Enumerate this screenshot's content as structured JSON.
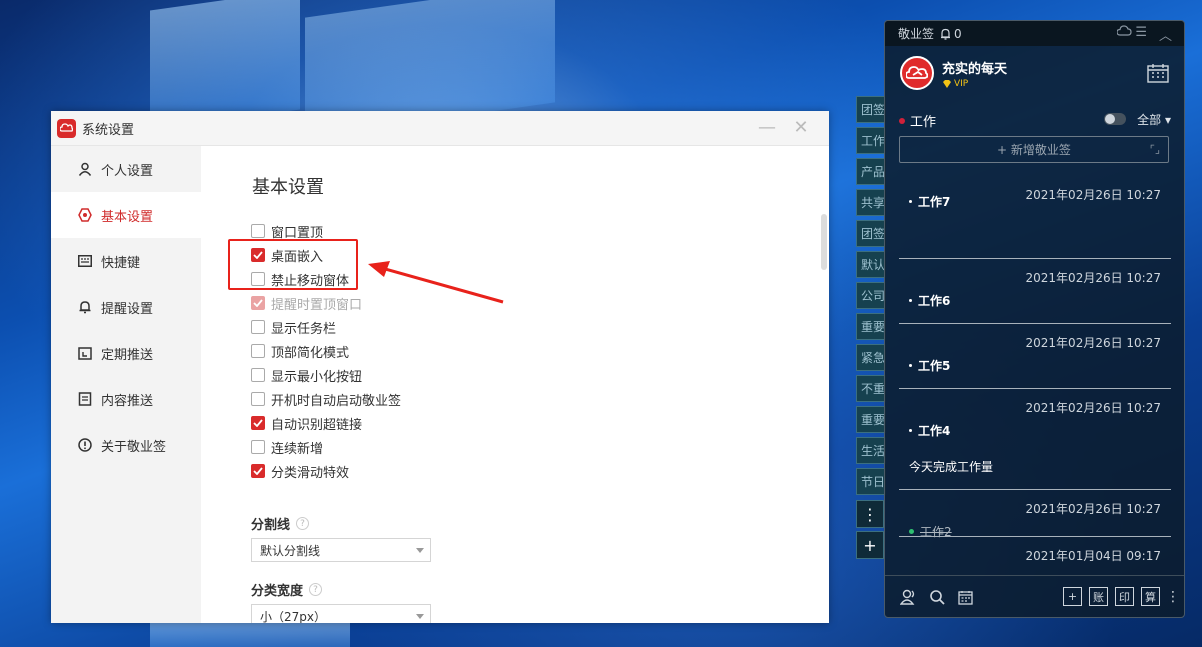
{
  "settings_window": {
    "title": "系统设置",
    "nav": [
      {
        "label": "个人设置",
        "icon": "person-icon",
        "active": false
      },
      {
        "label": "基本设置",
        "icon": "gear-icon",
        "active": true
      },
      {
        "label": "快捷键",
        "icon": "keyboard-icon",
        "active": false
      },
      {
        "label": "提醒设置",
        "icon": "bell-icon",
        "active": false
      },
      {
        "label": "定期推送",
        "icon": "calendar-icon",
        "active": false
      },
      {
        "label": "内容推送",
        "icon": "document-icon",
        "active": false
      },
      {
        "label": "关于敬业签",
        "icon": "info-icon",
        "active": false
      }
    ],
    "section_title": "基本设置",
    "options": [
      {
        "label": "窗口置顶",
        "state": "unchecked"
      },
      {
        "label": "桌面嵌入",
        "state": "checked"
      },
      {
        "label": "禁止移动窗体",
        "state": "unchecked"
      },
      {
        "label": "提醒时置顶窗口",
        "state": "disabled-checked"
      },
      {
        "label": "显示任务栏",
        "state": "unchecked"
      },
      {
        "label": "顶部简化模式",
        "state": "unchecked"
      },
      {
        "label": "显示最小化按钮",
        "state": "unchecked"
      },
      {
        "label": "开机时自动启动敬业签",
        "state": "unchecked"
      },
      {
        "label": "自动识别超链接",
        "state": "checked"
      },
      {
        "label": "连续新增",
        "state": "unchecked"
      },
      {
        "label": "分类滑动特效",
        "state": "checked"
      }
    ],
    "divider_label": "分割线",
    "divider_value": "默认分割线",
    "width_label": "分类宽度",
    "width_value": "小（27px）",
    "help_glyph": "?"
  },
  "side_tabs": [
    "团签",
    "工作",
    "产品",
    "共享",
    "团签",
    "默认",
    "公司",
    "重要",
    "紧急",
    "不重",
    "重要",
    "生活",
    "节日"
  ],
  "side_more": "⋮",
  "side_add": "+",
  "panel": {
    "app_name": "敬业签",
    "bell_count": "0",
    "profile_name": "充实的每天",
    "vip_label": "VIP",
    "category": "工作",
    "category_color": "#d0213a",
    "filter": "全部",
    "new_note": "新增敬业签",
    "notes": [
      {
        "date": "2021年02月26日 10:27",
        "title": "工作7",
        "body": "",
        "struck": false
      },
      {
        "date": "2021年02月26日 10:27",
        "title": "工作6",
        "body": "",
        "struck": false
      },
      {
        "date": "2021年02月26日 10:27",
        "title": "工作5",
        "body": "",
        "struck": false
      },
      {
        "date": "2021年02月26日 10:27",
        "title": "工作4",
        "body": "今天完成工作量",
        "struck": false
      },
      {
        "date": "2021年02月26日 10:27",
        "title": "工作2",
        "body": "",
        "struck": true,
        "dot_color": "#2fbf71"
      },
      {
        "date": "2021年01月04日 09:17",
        "title": "",
        "body": "",
        "struck": false
      }
    ],
    "bottom_buttons": [
      "+",
      "账",
      "印",
      "算"
    ],
    "more_glyph": "⋮"
  }
}
